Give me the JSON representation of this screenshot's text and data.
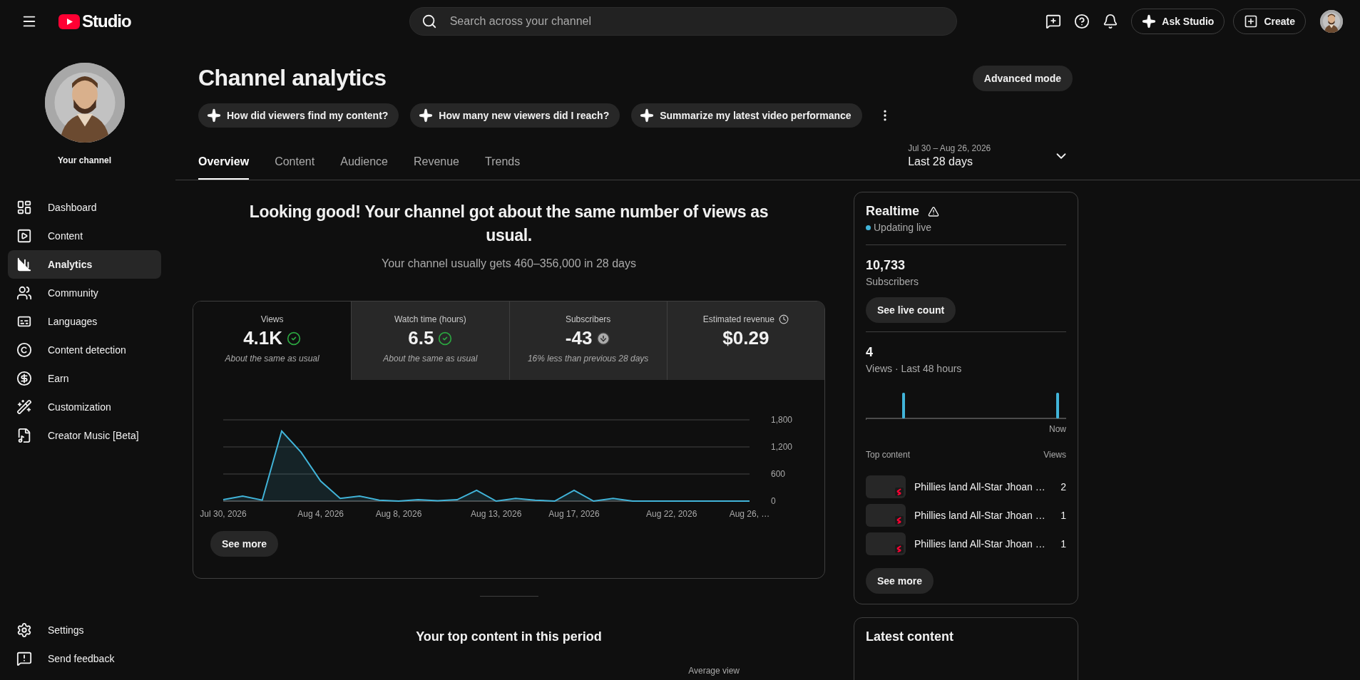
{
  "topbar": {
    "logo_text": "Studio",
    "search": {
      "placeholder": "Search across your channel"
    },
    "buttons": [
      {
        "label": "Ask Studio",
        "kind": "ask"
      },
      {
        "label": "Create",
        "kind": "create"
      }
    ]
  },
  "sidebar": {
    "channel_label": "Your channel",
    "items": [
      {
        "label": "Dashboard",
        "selected": false
      },
      {
        "label": "Content",
        "selected": false
      },
      {
        "label": "Analytics",
        "selected": true
      },
      {
        "label": "Community",
        "selected": false
      },
      {
        "label": "Languages",
        "selected": false
      },
      {
        "label": "Content detection",
        "selected": false
      },
      {
        "label": "Earn",
        "selected": false
      },
      {
        "label": "Customization",
        "selected": false
      },
      {
        "label": "Creator Music [Beta]",
        "selected": false
      }
    ],
    "footer_items": [
      {
        "label": "Settings"
      },
      {
        "label": "Send feedback"
      }
    ]
  },
  "page": {
    "title": "Channel analytics",
    "advanced_button": "Advanced mode",
    "suggestions": [
      "How did viewers find my content?",
      "How many new viewers did I reach?",
      "Summarize my latest video performance"
    ],
    "tabs": [
      {
        "label": "Overview",
        "selected": true
      },
      {
        "label": "Content",
        "selected": false
      },
      {
        "label": "Audience",
        "selected": false
      },
      {
        "label": "Revenue",
        "selected": false
      },
      {
        "label": "Trends",
        "selected": false
      }
    ],
    "date_range": {
      "range": "Jul 30 – Aug 26, 2026",
      "label": "Last 28 days"
    }
  },
  "summary": {
    "headline": "Looking good! Your channel got about the same number of views as usual.",
    "subtitle": "Your channel usually gets 460–356,000 in 28 days"
  },
  "metrics": [
    {
      "label": "Views",
      "value": "4.1K",
      "kind": "check",
      "note": "About the same as usual",
      "selected": true
    },
    {
      "label": "Watch time (hours)",
      "value": "6.5",
      "kind": "check",
      "note": "About the same as usual",
      "selected": false
    },
    {
      "label": "Subscribers",
      "value": "-43",
      "kind": "down",
      "note": "16% less than previous 28 days",
      "selected": false
    },
    {
      "label": "Estimated revenue",
      "value": "$0.29",
      "kind": "clock",
      "selected": false
    }
  ],
  "chart": {
    "chart_data": {
      "type": "area",
      "categories": [
        "Jul 30, 2026",
        null,
        null,
        null,
        null,
        "Aug 4, 2026",
        null,
        null,
        null,
        "Aug 8, 2026",
        null,
        null,
        null,
        null,
        "Aug 13, 2026",
        null,
        null,
        null,
        "Aug 17, 2026",
        null,
        null,
        null,
        null,
        "Aug 22, 2026",
        null,
        null,
        null,
        "Aug 26, …"
      ],
      "series": [
        {
          "color": "#41b4d9",
          "values": [
            30,
            110,
            20,
            1550,
            1080,
            440,
            60,
            110,
            20,
            0,
            30,
            10,
            30,
            240,
            0,
            60,
            20,
            0,
            240,
            0,
            60,
            0,
            0,
            0,
            0,
            0,
            0,
            0
          ]
        }
      ],
      "ylim": [
        0,
        1800
      ],
      "yticks": [
        {
          "value": 0,
          "label": "0"
        },
        {
          "value": 600,
          "label": "600"
        },
        {
          "value": 1200,
          "label": "1,200"
        },
        {
          "value": 1800,
          "label": "1,800"
        }
      ]
    },
    "see_more": "See more"
  },
  "top_content_section": {
    "title": "Your top content in this period",
    "column_label": "Average view"
  },
  "realtime": {
    "title": "Realtime",
    "status": "Updating live",
    "subscribers": {
      "value": "10,733",
      "label": "Subscribers",
      "button": "See live count"
    },
    "views": {
      "value": "4",
      "label": "Views · Last 48 hours",
      "axis_label": "Now"
    },
    "top_content": {
      "heading": "Top content",
      "column": "Views",
      "rows": [
        {
          "title": "Phillies land All-Star Jhoan …",
          "views": "2"
        },
        {
          "title": "Phillies land All-Star Jhoan …",
          "views": "1"
        },
        {
          "title": "Phillies land All-Star Jhoan …",
          "views": "1"
        }
      ]
    },
    "see_more": "See more"
  },
  "latest_content": {
    "title": "Latest content"
  }
}
